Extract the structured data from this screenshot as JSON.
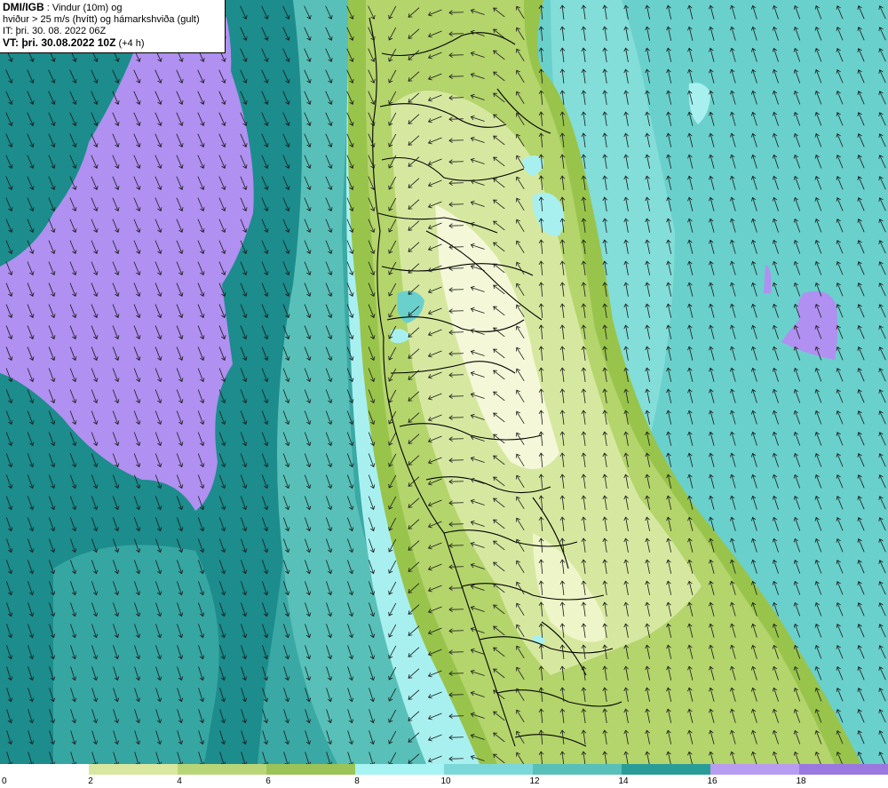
{
  "header": {
    "source": "DMI/IGB",
    "title_rest": " : Vindur (10m) og",
    "line2": "hviður > 25 m/s (hvítt) og hámarkshviða (gult)",
    "it_line": "IT: þri. 30. 08. 2022 06Z",
    "vt_label": "VT: þri. 30.08.2022 10Z",
    "vt_offset": " (+4 h)"
  },
  "legend": {
    "unit_ticks": [
      "0",
      "2",
      "4",
      "6",
      "8",
      "10",
      "12",
      "14",
      "16",
      "18"
    ],
    "colors": [
      "#ffffff",
      "#d8e8a0",
      "#b8d678",
      "#9ac458",
      "#a8f4f4",
      "#7cd8d8",
      "#58c0b8",
      "#2a9c98",
      "#b89cf0",
      "#9a78e0"
    ]
  },
  "palette": {
    "land_low": "#f4f8d8",
    "land_mid": "#d6e8a0",
    "land_high": "#b4d46c",
    "coast": "#98c44c",
    "sea_light": "#a8f0f0",
    "sea_mid": "#6ad0cc",
    "sea_dark": "#3aa8a4",
    "sea_darker": "#1c8c8c",
    "strong": "#b090f0",
    "contour": "#000000",
    "arrow": "#1a1a1a"
  }
}
